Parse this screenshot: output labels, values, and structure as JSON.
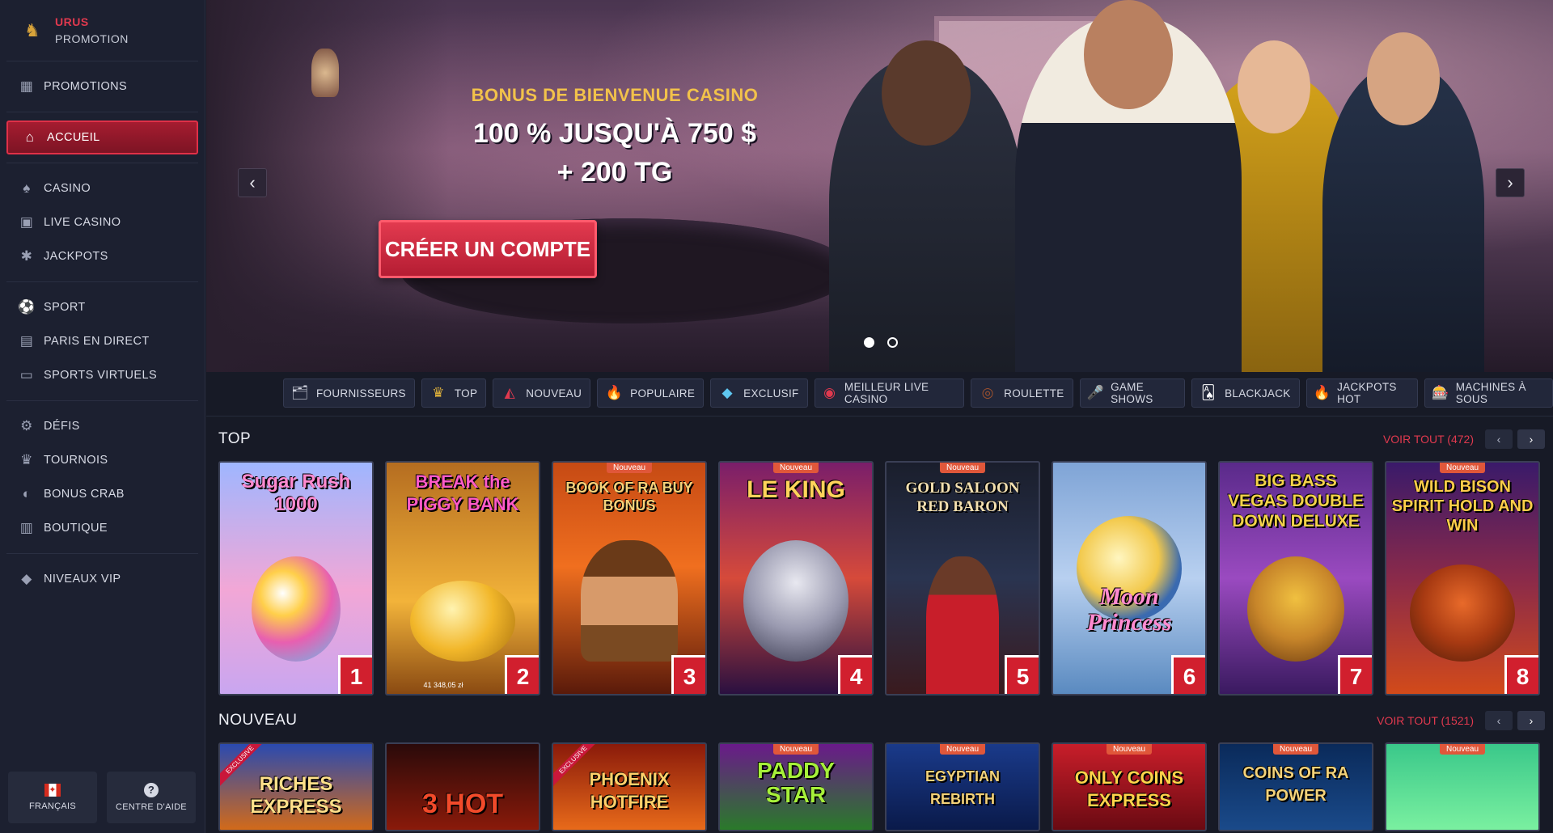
{
  "brand": {
    "line1": "URUS",
    "line2": "PROMOTION"
  },
  "sidebar": {
    "items": [
      {
        "label": "PROMOTIONS",
        "icon": "gift-icon"
      },
      {
        "label": "ACCUEIL",
        "icon": "home-icon",
        "active": true
      },
      {
        "label": "CASINO",
        "icon": "spade-icon"
      },
      {
        "label": "LIVE CASINO",
        "icon": "live-casino-icon"
      },
      {
        "label": "JACKPOTS",
        "icon": "jackpot-icon"
      },
      {
        "label": "SPORT",
        "icon": "ball-icon"
      },
      {
        "label": "PARIS EN DIRECT",
        "icon": "live-bet-icon"
      },
      {
        "label": "SPORTS VIRTUELS",
        "icon": "virtual-sports-icon"
      },
      {
        "label": "DÉFIS",
        "icon": "challenge-icon"
      },
      {
        "label": "TOURNOIS",
        "icon": "trophy-icon"
      },
      {
        "label": "BONUS CRAB",
        "icon": "crab-icon"
      },
      {
        "label": "BOUTIQUE",
        "icon": "shop-icon"
      },
      {
        "label": "NIVEAUX VIP",
        "icon": "diamond-icon"
      }
    ],
    "language_label": "FRANÇAIS",
    "help_label": "CENTRE D'AIDE"
  },
  "hero": {
    "subtitle": "BONUS DE BIENVENUE CASINO",
    "title": "100 % JUSQU'À 750 $ + 200 TG",
    "cta": "CRÉER UN COMPTE"
  },
  "categories": [
    {
      "label": "FOURNISSEURS",
      "icon": "providers-icon"
    },
    {
      "label": "TOP",
      "icon": "crown-icon"
    },
    {
      "label": "NOUVEAU",
      "icon": "new-icon"
    },
    {
      "label": "POPULAIRE",
      "icon": "fire-icon"
    },
    {
      "label": "EXCLUSIF",
      "icon": "gem-icon"
    },
    {
      "label": "MEILLEUR LIVE CASINO",
      "icon": "chip-icon"
    },
    {
      "label": "ROULETTE",
      "icon": "roulette-icon"
    },
    {
      "label": "GAME SHOWS",
      "icon": "microphone-icon"
    },
    {
      "label": "BLACKJACK",
      "icon": "cards-icon"
    },
    {
      "label": "JACKPOTS HOT",
      "icon": "hot-icon"
    },
    {
      "label": "MACHINES À SOUS",
      "icon": "slot-icon"
    }
  ],
  "sections": {
    "top": {
      "title": "TOP",
      "see_all": "VOIR TOUT (472)",
      "games": [
        {
          "name": "Sugar Rush 1000",
          "rank": "1"
        },
        {
          "name": "BREAK the PIGGY BANK",
          "rank": "2",
          "amount": "41 348,05 zł"
        },
        {
          "name": "BOOK OF RA BUY BONUS",
          "rank": "3",
          "badge": "Nouveau"
        },
        {
          "name": "LE KING",
          "rank": "4",
          "badge": "Nouveau"
        },
        {
          "name": "GOLD SALOON RED BARON",
          "rank": "5",
          "badge": "Nouveau"
        },
        {
          "name": "Moon Princess",
          "rank": "6"
        },
        {
          "name": "BIG BASS VEGAS DOUBLE DOWN DELUXE",
          "rank": "7"
        },
        {
          "name": "WILD BISON SPIRIT HOLD AND WIN",
          "rank": "8",
          "badge": "Nouveau"
        }
      ]
    },
    "new": {
      "title": "NOUVEAU",
      "see_all": "VOIR TOUT (1521)",
      "games": [
        {
          "name": "RICHES EXPRESS",
          "ribbon": "EXCLUSIVE"
        },
        {
          "name": "3 HOT"
        },
        {
          "name": "PHOENIX HOTFIRE",
          "ribbon": "EXCLUSIVE"
        },
        {
          "name": "PADDY STAR",
          "badge": "Nouveau"
        },
        {
          "name": "EGYPTIAN REBIRTH",
          "badge": "Nouveau"
        },
        {
          "name": "ONLY COINS EXPRESS",
          "badge": "Nouveau"
        },
        {
          "name": "COINS OF RA POWER",
          "badge": "Nouveau"
        },
        {
          "name": "",
          "badge": "Nouveau"
        }
      ]
    }
  },
  "colors": {
    "accent": "#e0394e",
    "sidebar_bg": "#1c2030",
    "page_bg": "#171a26",
    "gold": "#f2c24a"
  }
}
